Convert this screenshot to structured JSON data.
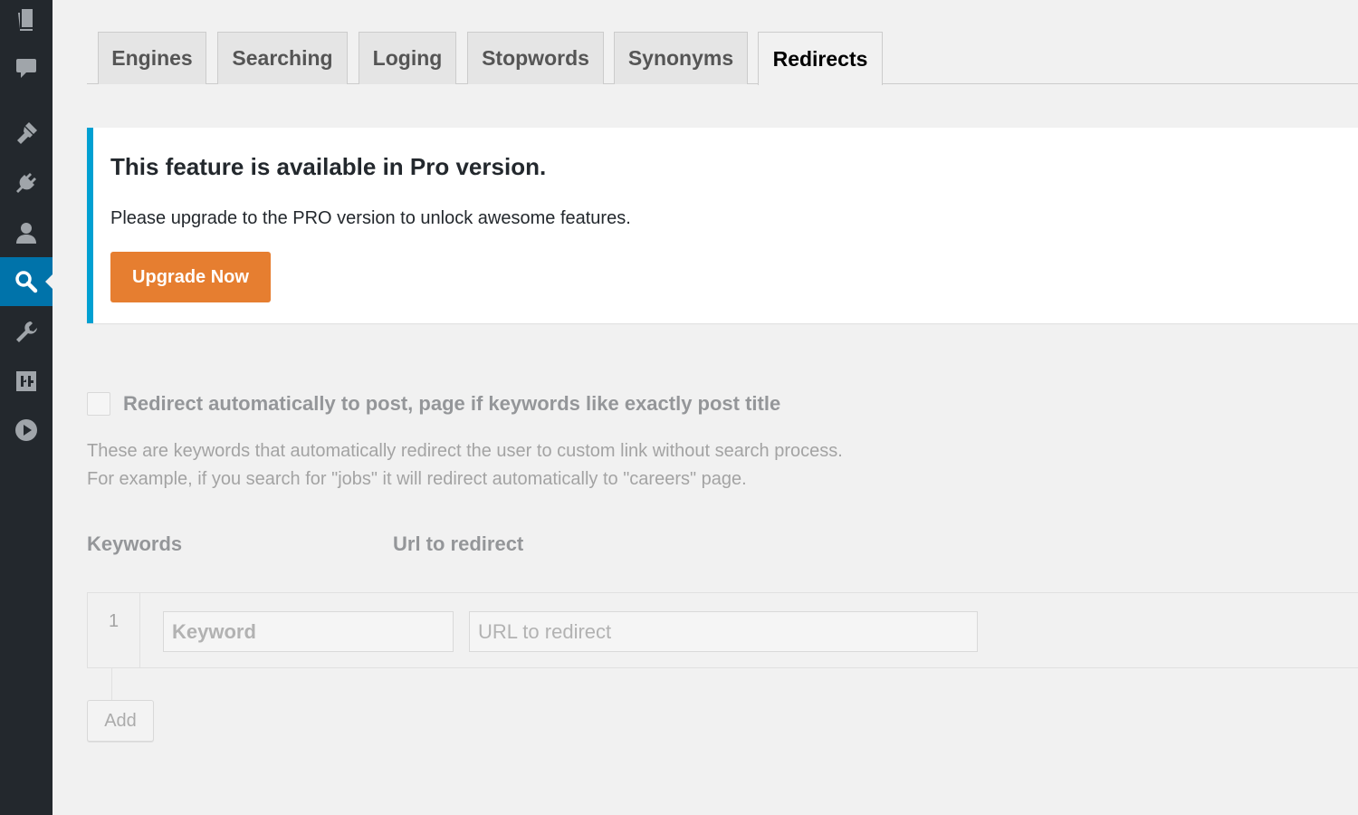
{
  "sidebar": {
    "items": [
      {
        "icon": "pages-icon"
      },
      {
        "icon": "comments-icon"
      },
      {
        "icon": "appearance-icon"
      },
      {
        "icon": "plugins-icon"
      },
      {
        "icon": "users-icon"
      },
      {
        "icon": "search-icon",
        "active": true
      },
      {
        "icon": "tools-icon"
      },
      {
        "icon": "settings-icon"
      },
      {
        "icon": "play-icon"
      }
    ]
  },
  "tabs": [
    {
      "label": "Engines"
    },
    {
      "label": "Searching"
    },
    {
      "label": "Loging"
    },
    {
      "label": "Stopwords"
    },
    {
      "label": "Synonyms"
    },
    {
      "label": "Redirects",
      "active": true
    }
  ],
  "notice": {
    "title": "This feature is available in Pro version.",
    "text": "Please upgrade to the PRO version to unlock awesome features.",
    "button_label": "Upgrade Now"
  },
  "redirect_settings": {
    "checkbox_label": "Redirect automatically to post, page if keywords like exactly post title",
    "checkbox_checked": false,
    "description_line1": "These are keywords that automatically redirect the user to custom link without search process.",
    "description_line2": "For example, if you search for \"jobs\" it will redirect automatically to \"careers\" page.",
    "column_keywords": "Keywords",
    "column_url": "Url to redirect",
    "rows": [
      {
        "number": "1",
        "keyword_placeholder": "Keyword",
        "url_placeholder": "URL to redirect"
      }
    ],
    "add_label": "Add"
  },
  "colors": {
    "sidebar_bg": "#23282d",
    "sidebar_active": "#0073aa",
    "notice_accent": "#00a0d2",
    "upgrade_button": "#e67e30",
    "page_bg": "#f1f1f1"
  }
}
